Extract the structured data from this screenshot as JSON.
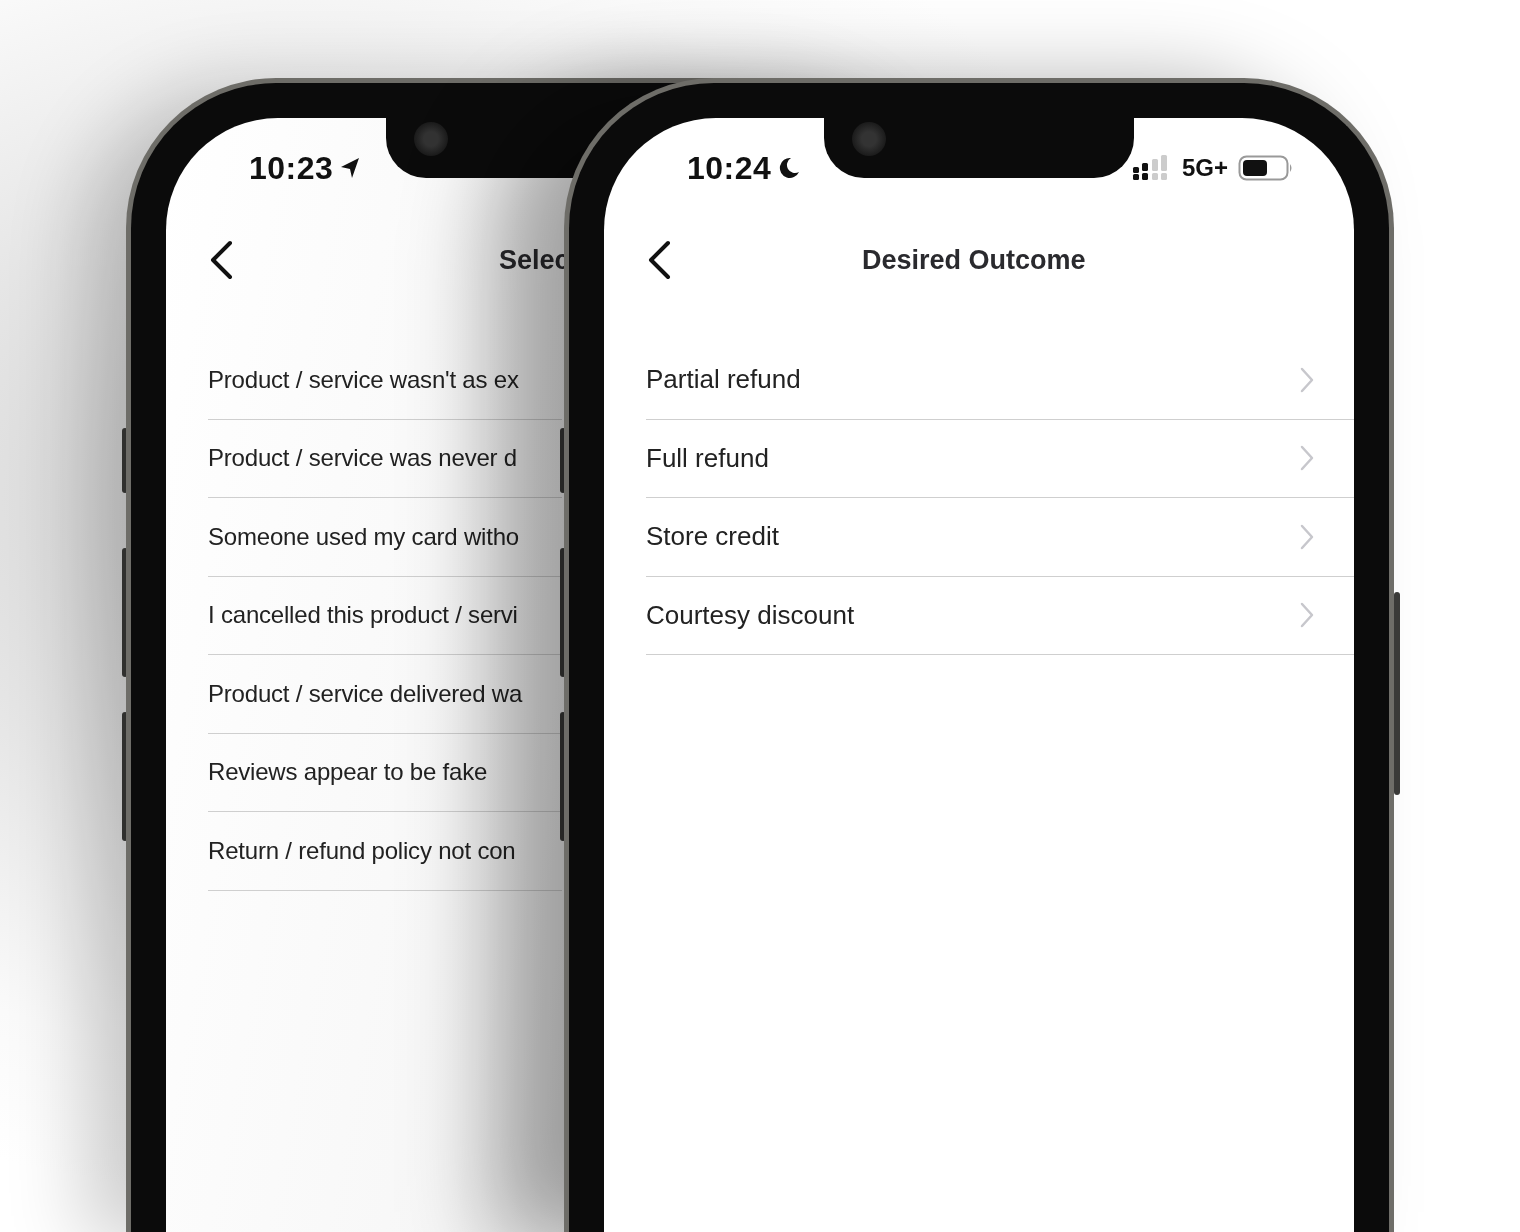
{
  "phones": [
    {
      "kind": "back",
      "status_bar": {
        "time": "10:23"
      },
      "nav": {
        "title": "Selec"
      },
      "options": [
        {
          "label": "Product / service wasn't as ex"
        },
        {
          "label": "Product / service was never d"
        },
        {
          "label": "Someone used my card witho"
        },
        {
          "label": "I cancelled this product / servi"
        },
        {
          "label": "Product / service delivered wa"
        },
        {
          "label": "Reviews appear to be fake"
        },
        {
          "label": "Return / refund policy not con"
        }
      ]
    },
    {
      "kind": "front",
      "status_bar": {
        "time": "10:24",
        "network": "5G+"
      },
      "nav": {
        "title": "Desired Outcome"
      },
      "options": [
        {
          "label": "Partial refund"
        },
        {
          "label": "Full refund"
        },
        {
          "label": "Store credit"
        },
        {
          "label": "Courtesy discount"
        }
      ]
    }
  ]
}
